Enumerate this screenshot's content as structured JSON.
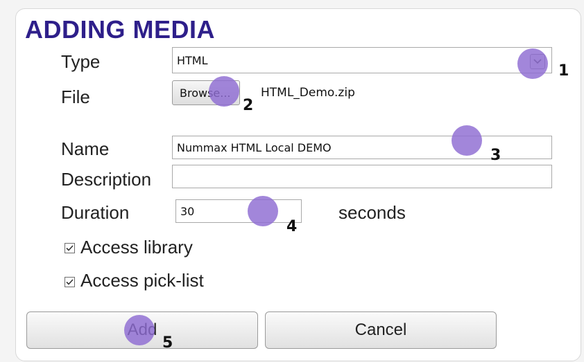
{
  "dialog": {
    "title": "ADDING MEDIA"
  },
  "form": {
    "type": {
      "label": "Type",
      "value": "HTML"
    },
    "file": {
      "label": "File",
      "browse_label": "Browse...",
      "filename": "HTML_Demo.zip"
    },
    "name": {
      "label": "Name",
      "value": "Nummax HTML Local DEMO"
    },
    "description": {
      "label": "Description",
      "value": ""
    },
    "duration": {
      "label": "Duration",
      "value": "30",
      "unit": "seconds"
    },
    "checkboxes": [
      {
        "label": "Access library",
        "checked": true
      },
      {
        "label": "Access pick-list",
        "checked": true
      }
    ]
  },
  "buttons": {
    "add_label": "Add",
    "cancel_label": "Cancel"
  },
  "annotations": {
    "markers": [
      "1",
      "2",
      "3",
      "4",
      "5"
    ],
    "color": "#8e6bd2"
  }
}
